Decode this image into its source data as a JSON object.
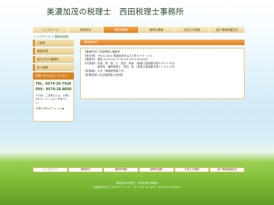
{
  "header": {
    "title": "美濃加茂の税理士　西田税理士事務所"
  },
  "nav": [
    {
      "label": "トップページ",
      "active": false
    },
    {
      "label": "業務案内",
      "active": false
    },
    {
      "label": "事務所概要",
      "active": true
    },
    {
      "label": "顧問先募集",
      "active": false
    },
    {
      "label": "お役立ち情報",
      "active": false
    },
    {
      "label": "個人情報保護宣言",
      "active": false
    }
  ],
  "breadcrumb": "トップページ > 事務所概要",
  "sidebar": {
    "items": [
      "ご挨拶",
      "業務内容",
      "協力された顧問先",
      "求人情報"
    ],
    "contact": {
      "heading": "お問い合わせはこちらから",
      "tel": "TEL：0574-26-7428",
      "fax": "FAX：0574-26-8050",
      "note": "その他、ご質問などは、お問い合わせフォームをご利用下さい。",
      "link": "お問い合わせフォーム ▶"
    }
  },
  "main": {
    "heading": "事務所紹介",
    "lines": [
      "【事務所名】西田税理士事務所",
      "【所在地】 〒505-0000 美濃加茂市山之上町９９９－２６",
      "【連絡先】 電話 0574-26-74 28 FAX 0574-26-8050",
      "【代表者】 所長　税　理　士　西田　卓彦　(税理士登録番号第５８６７８号)",
      "　　　　　 副所長　補助税理士　西田　英　(税理士登録番号第１１５３４号)",
      "【従業員】 ８名（資格取得者２名）",
      "【所属団体】名古屋税理士会所属"
    ]
  },
  "footer": {
    "nav": [
      "トップページ",
      "業務案内",
      "事務所概要",
      "顧問先募集",
      "お役立ち情報",
      "個人情報保護宣言"
    ],
    "lines": [
      "美濃加茂の税理士　西田税理士事務所",
      "美濃加茂市山之上町９９９－２６　TEL 0574-26-7428　FAX 0574-26-8050"
    ]
  }
}
